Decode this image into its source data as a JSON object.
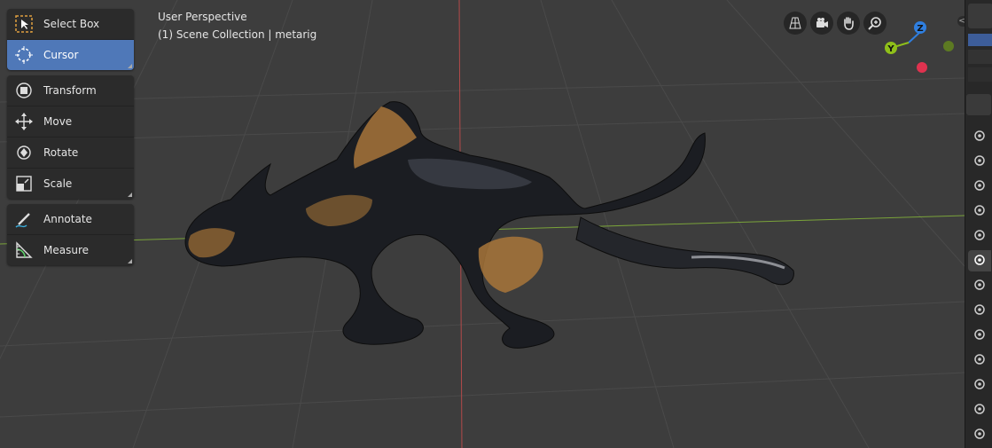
{
  "viewport": {
    "view_name": "User Perspective",
    "collection_info": "(1) Scene Collection | metarig"
  },
  "toolbar": {
    "groups": [
      [
        {
          "label": "Select Box",
          "icon": "select-box-icon",
          "active": false
        },
        {
          "label": "Cursor",
          "icon": "cursor-icon",
          "active": true
        }
      ],
      [
        {
          "label": "Transform",
          "icon": "transform-icon",
          "active": false
        },
        {
          "label": "Move",
          "icon": "move-icon",
          "active": false
        },
        {
          "label": "Rotate",
          "icon": "rotate-icon",
          "active": false
        },
        {
          "label": "Scale",
          "icon": "scale-icon",
          "active": false
        }
      ],
      [
        {
          "label": "Annotate",
          "icon": "annotate-icon",
          "active": false
        },
        {
          "label": "Measure",
          "icon": "measure-icon",
          "active": false
        }
      ]
    ]
  },
  "navigation_gizmo": {
    "z_label": "Z",
    "y_label": "Y",
    "colors": {
      "z": "#2f7fe0",
      "y": "#8fbf1a",
      "x": "#e0324f"
    }
  },
  "nav_buttons": [
    "toggle-grid-icon",
    "camera-view-icon",
    "pan-hand-icon",
    "zoom-icon"
  ],
  "properties_tabs": [
    "tool-icon",
    "render-icon",
    "output-icon",
    "view-layer-icon",
    "scene-icon",
    "world-icon",
    "object-icon",
    "modifier-icon",
    "particles-icon",
    "physics-icon",
    "constraints-icon",
    "data-icon",
    "texture-icon"
  ],
  "colors": {
    "viewport_bg": "#3d3d3d",
    "grid_line": "#4a4a4a",
    "x_axis": "#7aa33a",
    "y_axis": "#b34a4a",
    "panel_bg": "#2b2b2b",
    "active_tool": "#4f78b8"
  }
}
